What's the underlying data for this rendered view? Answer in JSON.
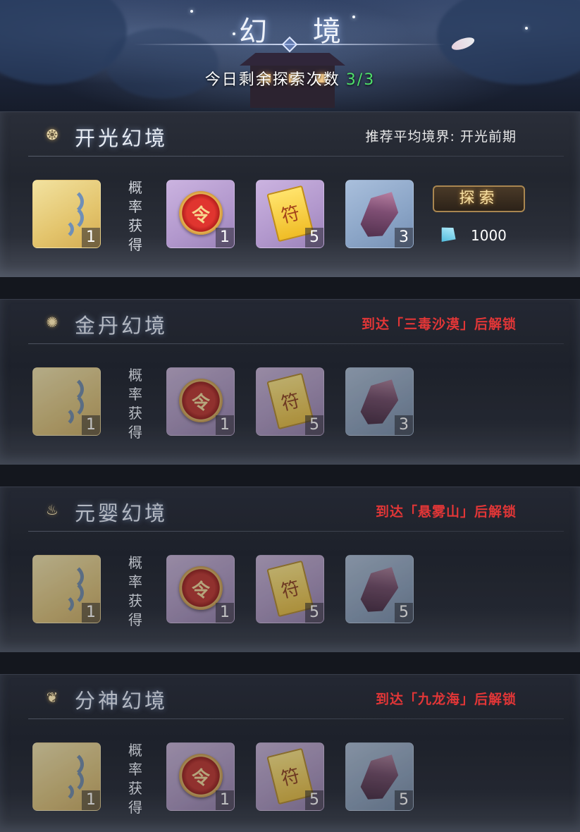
{
  "header": {
    "title": "幻 境",
    "explore_label": "今日剩余探索次数",
    "explore_count": "3/3"
  },
  "prob_label": "概率获得",
  "realms": [
    {
      "name": "开光幻境",
      "requirement": "推荐平均境界: 开光前期",
      "locked": false,
      "items": [
        {
          "icon": "wisp-icon",
          "qty": "1"
        },
        {
          "icon": "red-token-icon",
          "qty": "1"
        },
        {
          "icon": "yellow-talisman-icon",
          "qty": "5"
        },
        {
          "icon": "purple-crystal-icon",
          "qty": "3"
        }
      ],
      "explore_button": "探索",
      "cost": "1000"
    },
    {
      "name": "金丹幻境",
      "requirement": "到达「三毒沙漠」后解锁",
      "locked": true,
      "items": [
        {
          "icon": "wisp-icon",
          "qty": "1"
        },
        {
          "icon": "red-token-icon",
          "qty": "1"
        },
        {
          "icon": "yellow-talisman-icon",
          "qty": "5"
        },
        {
          "icon": "purple-crystal-icon",
          "qty": "3"
        }
      ]
    },
    {
      "name": "元婴幻境",
      "requirement": "到达「悬雾山」后解锁",
      "locked": true,
      "items": [
        {
          "icon": "wisp-icon",
          "qty": "1"
        },
        {
          "icon": "red-token-icon",
          "qty": "1"
        },
        {
          "icon": "yellow-talisman-icon",
          "qty": "5"
        },
        {
          "icon": "purple-crystal-icon",
          "qty": "5"
        }
      ]
    },
    {
      "name": "分神幻境",
      "requirement": "到达「九龙海」后解锁",
      "locked": true,
      "items": [
        {
          "icon": "wisp-icon",
          "qty": "1"
        },
        {
          "icon": "red-token-icon",
          "qty": "1"
        },
        {
          "icon": "yellow-talisman-icon",
          "qty": "5"
        },
        {
          "icon": "purple-crystal-icon",
          "qty": "5"
        }
      ]
    }
  ],
  "colors": {
    "count_green": "#4ee06a",
    "lock_red": "#ff3b3b",
    "gold_frame": "#a98650"
  }
}
